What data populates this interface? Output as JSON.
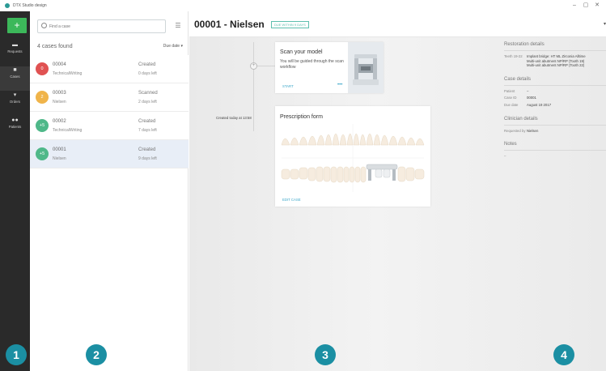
{
  "app": {
    "title": "DTX Studio design",
    "controls": [
      "–",
      "▢",
      "✕"
    ]
  },
  "rail": {
    "add_label": "+",
    "items": [
      {
        "label": "Requests",
        "icon": "chat-icon"
      },
      {
        "label": "Cases",
        "icon": "folder-icon"
      },
      {
        "label": "Orders",
        "icon": "cart-icon"
      },
      {
        "label": "Patients",
        "icon": "users-icon"
      }
    ]
  },
  "list": {
    "search_placeholder": "Find a case",
    "count_label": "4 cases found",
    "sort_label": "Due date ▾",
    "cases": [
      {
        "badge": "0",
        "color": "#e05252",
        "id": "00004",
        "name": "TechnicalWriting",
        "status": "Created",
        "days": "0 days left"
      },
      {
        "badge": "2",
        "color": "#f0b44a",
        "id": "00003",
        "name": "Nielsen",
        "status": "Scanned",
        "days": "2 days left"
      },
      {
        "badge": "+5",
        "color": "#4fb889",
        "id": "00002",
        "name": "TechnicalWriting",
        "status": "Created",
        "days": "7 days left"
      },
      {
        "badge": "+5",
        "color": "#4fb889",
        "id": "00001",
        "name": "Nielsen",
        "status": "Created",
        "days": "9 days left"
      }
    ]
  },
  "main": {
    "title": "00001 - Nielsen",
    "due_badge": "DUE WITHIN 9 DAYS",
    "timeline_node": "+",
    "created_label": "Created today at 13:58",
    "scan_card": {
      "title": "Scan your model",
      "description": "You will be guided through the scan workflow",
      "start": "START",
      "more": "•••"
    },
    "rx_card": {
      "title": "Prescription form",
      "edit": "EDIT CASE"
    }
  },
  "details": {
    "restoration": {
      "title": "Restoration details",
      "key": "Teeth 19-22",
      "lines": [
        "Implant bridge: HT ML Zirconia Alltime",
        "Multi-unit abutment NP/RP (Tooth 19)",
        "Multi-unit abutment NP/RP (Tooth 22)"
      ]
    },
    "case": {
      "title": "Case details",
      "rows": [
        {
          "k": "Patient",
          "v": "–"
        },
        {
          "k": "Case ID",
          "v": "00001"
        },
        {
          "k": "Due date",
          "v": "August 19 2017"
        }
      ]
    },
    "clinician": {
      "title": "Clinician details",
      "rows": [
        {
          "k": "Requested by",
          "v": "Nielsen"
        }
      ]
    },
    "notes": {
      "title": "Notes",
      "value": "–"
    }
  },
  "callouts": [
    "1",
    "2",
    "3",
    "4"
  ],
  "colors": {
    "accent": "#1b8fa3",
    "add": "#3cb85a",
    "link": "#3aa6c9"
  }
}
